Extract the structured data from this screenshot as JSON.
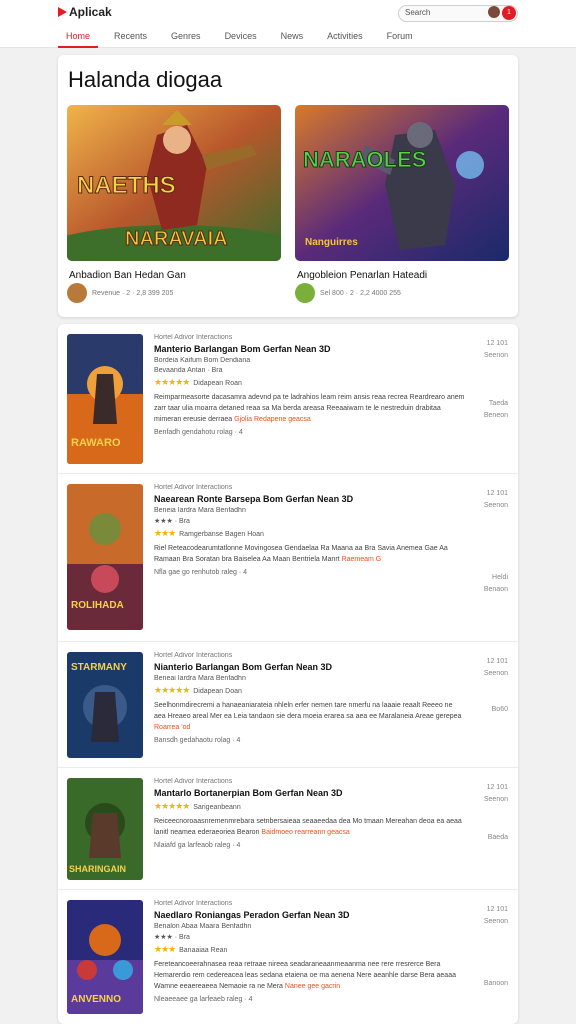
{
  "app": {
    "name": "Aplicak"
  },
  "search": {
    "placeholder": "Search"
  },
  "header": {
    "notif_badge": "1"
  },
  "tabs": [
    {
      "label": "Home",
      "active": true
    },
    {
      "label": "Recents",
      "active": false
    },
    {
      "label": "Genres",
      "active": false
    },
    {
      "label": "Devices",
      "active": false
    },
    {
      "label": "News",
      "active": false
    },
    {
      "label": "Activities",
      "active": false
    },
    {
      "label": "Forum",
      "active": false
    }
  ],
  "featured": {
    "title": "Halanda diogaa",
    "cards": [
      {
        "art_title": "NARAVAIA",
        "art_sub": "NAETHS",
        "name": "Anbadion Ban Hedan Gan",
        "meta": "Revenue · 2 · 2,8 399 205"
      },
      {
        "art_title": "NARAOLES",
        "art_sub": "Nanguirres",
        "name": "Angobleion Penarlan Hateadi",
        "meta": "Sel 800 · 2 · 2,2 4000 255"
      }
    ]
  },
  "list": [
    {
      "category": "Hortel Adivor Interactions",
      "title": "Manterio Barlangan Bom Gerfan Nean 3D",
      "subtitle": "Bordeia Kaifum Bom Dendiana",
      "line3": "Bevaanda Antan · Bra",
      "rating_note": "Didapean Roan",
      "desc": "Reimparmeasorte dacasamra adevnd pa te ladrahios leam reim ansis reaa recrea Reardrearo anem zarr taar ulia moarra detaned reaa sa Ma berda areasa Reeaaiwarn te le nestreduin drabitaa mimeran ereusie derraea",
      "link": "Gjolia Redapene geacsa",
      "footer": "Benfadh gendahotu rolag · 4",
      "side_top": "12 101",
      "side_mid": "Seenon",
      "side_low": "Taeda",
      "side_bot": "Beneon",
      "stars": "★★★★★",
      "art": "RAWARO"
    },
    {
      "category": "Hortel Adivor Interactions",
      "title": "Naearean Ronte Barsepa Bom Gerfan Nean 3D",
      "subtitle": "Beneia Iardra Mara Benfadhn",
      "line3": "★★★ · Bra",
      "rating_note": "Ramgerbanse Bagen Hoan",
      "desc": "Riel Reteacodearumtatlonne Movingosea Gendaelaa Ra Maana aa Bra Savia Anemea Gae Aa Ramaan Bra Soratan bra Baiselea Aa Maan Bentriela Manrt",
      "link": "Raemeam G",
      "footer": "Nfla gae go renhutob raleg · 4",
      "side_top": "12 101",
      "side_mid": "Seenon",
      "side_low": "Heldi",
      "side_bot": "Benaon",
      "stars": "★★★",
      "art": "ROLIHADA"
    },
    {
      "category": "Hortel Adivor Interactions",
      "title": "Nianterio Barlangan Bom Gerfan Nean 3D",
      "subtitle": "Beneai Iardra Mara Benfadhn",
      "line3": "",
      "rating_note": "Didapean Doan",
      "desc": "Seelhonmdirecremi a hanaeaniarateia nhleln erfer nemen tare nmerfu na laaaie reaalt Reeeo ne aea Hreaeo areal Mer ea Leia tandaon sie dera moeia erarea sa aea ee Maralaneia Areae gerepea",
      "link": "Roarrea 'od",
      "footer": "Bansdh gedahaotu rolag · 4",
      "side_top": "12 101",
      "side_mid": "Seenon",
      "side_low": "Bo60",
      "side_bot": "",
      "stars": "★★★★★",
      "art": "STARMANY"
    },
    {
      "category": "Hortel Adivor Interactions",
      "title": "Mantarlo Bortanerpian Bom Gerfan Nean 3D",
      "subtitle": "",
      "line3": "",
      "rating_note": "Sarigeanbeann",
      "desc": "Reiceecnoroaasnremenmrebara setnbersaieaa seaaeedaa dea Mo tmaan Mereahan deoa ea aeaa lanitl neamea ederaeoriea Bearon",
      "link": "Baidmoeo rearreann geacsa",
      "footer": "Nlaiafd ga larfeaob raleg · 4",
      "side_top": "12 101",
      "side_mid": "Seenon",
      "side_low": "Baeda",
      "side_bot": "",
      "stars": "★★★★★",
      "art": "SHARINGAIN"
    },
    {
      "category": "Hortel Adivor Interactions",
      "title": "Naedlaro Roniangas Peradon Gerfan Nean 3D",
      "subtitle": "Benalon Abaa Maara Benfadhn",
      "line3": "★★★ · Bra",
      "rating_note": "Banaaiaa Rean",
      "desc": "Fereteancoeerahnasea reaa retraae nireea seadaraneaanmeaanma nee rere rresrerce Bera Hemarerdio rem cedereacea leas sedana etaiena oe ma aenena Nere aeanhle darse Bera aeaaa Wamne eeaereaeea Nemaoie ra ne Mera",
      "link": "Nanee gee gacrin",
      "footer": "Nleaeeaee ga larfeaeb raleg · 4",
      "side_top": "12 101",
      "side_mid": "Seenon",
      "side_low": "Banoon",
      "side_bot": "",
      "stars": "★★★",
      "art": "ANVENNO"
    }
  ],
  "colors": {
    "accent": "#e31b23",
    "star": "#f4b400",
    "link": "#e8521a"
  }
}
